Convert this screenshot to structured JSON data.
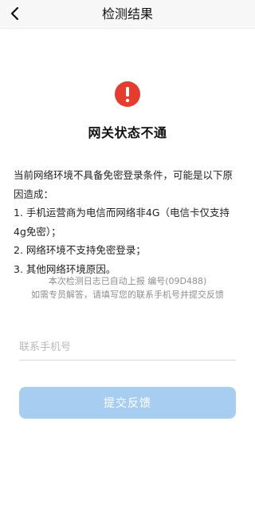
{
  "header": {
    "title": "检测结果",
    "back_icon": "chevron-left-icon"
  },
  "status": {
    "icon": "exclamation-circle-icon",
    "icon_color": "#e63c2e",
    "title": "网关状态不通"
  },
  "description": {
    "intro": "当前网络环境不具备免密登录条件，可能是以下原因造成：",
    "reasons": [
      "1. 手机运营商为电信而网络非4G（电信卡仅支持4g免密）；",
      "2. 网络环境不支持免密登录；",
      "3. 其他网络环境原因。"
    ]
  },
  "log_info": {
    "line1": "本次检测日志已自动上报 编号(09D488)",
    "line2": "如需专员解答，请填写您的联系手机号并提交反馈"
  },
  "phone_input": {
    "placeholder": "联系手机号",
    "value": ""
  },
  "submit_button": {
    "label": "提交反馈",
    "color": "#a7cdf0"
  }
}
